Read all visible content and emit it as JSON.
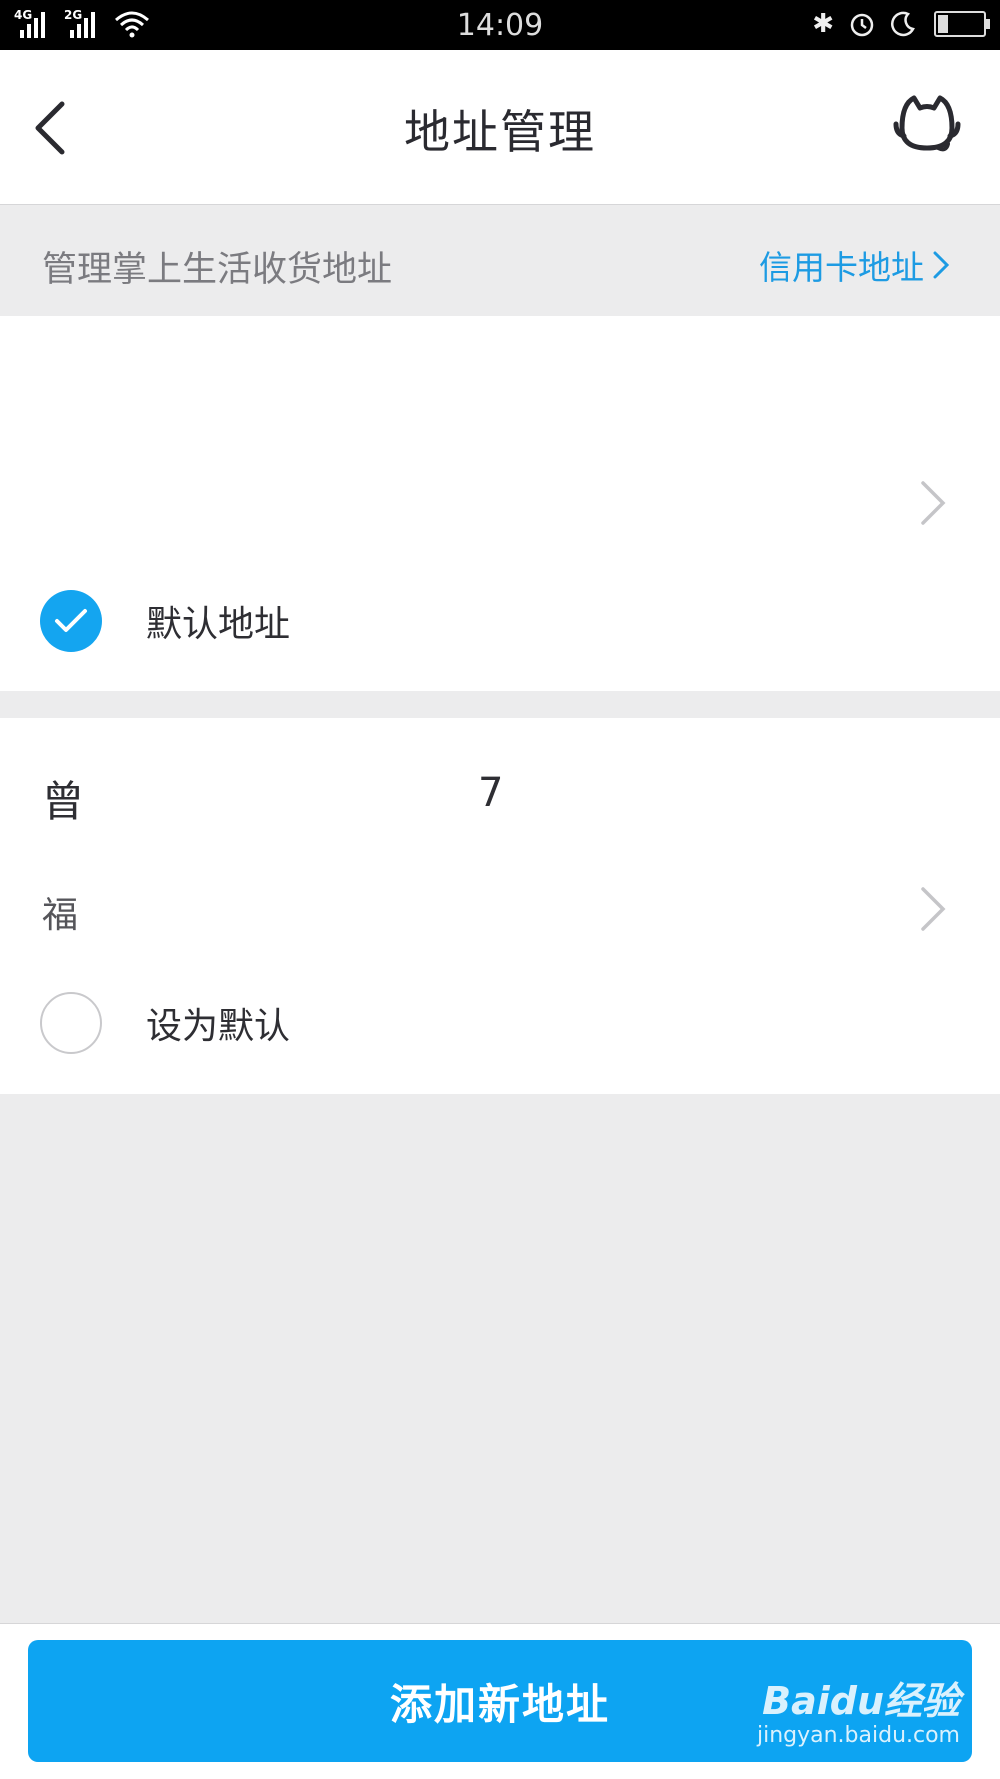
{
  "status_bar": {
    "time": "14:09",
    "signal1": "4G",
    "signal2": "2G"
  },
  "nav": {
    "title": "地址管理"
  },
  "subheader": {
    "description": "管理掌上生活收货地址",
    "credit_card_link": "信用卡地址"
  },
  "addresses": [
    {
      "default_label": "默认地址",
      "checked": true
    },
    {
      "name": "曾",
      "phone": "7",
      "address": "福",
      "default_label": "设为默认",
      "checked": false
    }
  ],
  "actions": {
    "add_new": "添加新地址"
  },
  "watermark": {
    "brand": "Baidu经验",
    "url": "jingyan.baidu.com"
  },
  "colors": {
    "accent": "#14a5f0",
    "link": "#1d9be3",
    "background": "#ececed"
  }
}
